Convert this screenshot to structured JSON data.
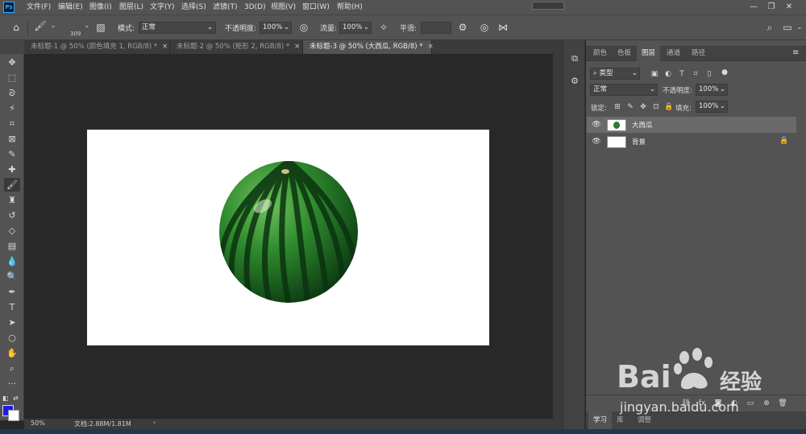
{
  "app": {
    "logo": "Ps",
    "menu": [
      "文件(F)",
      "编辑(E)",
      "图像(I)",
      "图层(L)",
      "文字(Y)",
      "选择(S)",
      "滤镜(T)",
      "3D(D)",
      "视图(V)",
      "窗口(W)",
      "帮助(H)"
    ],
    "window_controls": [
      "minimize",
      "restore",
      "close"
    ]
  },
  "options": {
    "brush_size": "309",
    "mode_label": "模式:",
    "mode_value": "正常",
    "opacity_label": "不透明度:",
    "opacity_value": "100%",
    "flow_label": "流量:",
    "flow_value": "100%",
    "smoothing_label": "平滑:",
    "smoothing_value": ""
  },
  "tabs": [
    {
      "label": "未标题-1 @ 50% (颜色填充 1, RGB/8) *",
      "active": false
    },
    {
      "label": "未标题-2 @ 50% (矩形 2, RGB/8) *",
      "active": false
    },
    {
      "label": "未标题-3 @ 50% (大西瓜, RGB/8) *",
      "active": true
    }
  ],
  "tools": [
    "move-icon",
    "marquee-icon",
    "lasso-icon",
    "magic-wand-icon",
    "crop-icon",
    "frame-icon",
    "eyedropper-icon",
    "healing-icon",
    "brush-icon",
    "stamp-icon",
    "history-brush-icon",
    "eraser-icon",
    "gradient-icon",
    "blur-icon",
    "dodge-icon",
    "pen-icon",
    "type-icon",
    "path-select-icon",
    "ellipse-icon",
    "hand-icon",
    "zoom-icon",
    "more-icon"
  ],
  "colors": {
    "foreground": "#1d1de8",
    "background": "#ffffff",
    "menubar": "#535353",
    "workspace": "#282828"
  },
  "status": {
    "zoom": "50%",
    "doc_info": "文档:2.88M/1.81M"
  },
  "panel": {
    "tabs": [
      "颜色",
      "色板",
      "图层",
      "通道",
      "路径"
    ],
    "active_tab": "图层",
    "filter_kind": "类型",
    "blend_mode": "正常",
    "opacity_label": "不透明度:",
    "opacity_value": "100%",
    "lock_label": "锁定:",
    "fill_label": "填充:",
    "fill_value": "100%",
    "layers": [
      {
        "name": "大西瓜",
        "selected": true,
        "visible": true,
        "locked": false
      },
      {
        "name": "背景",
        "selected": false,
        "visible": true,
        "locked": true
      }
    ],
    "bottom_tabs": [
      "学习",
      "库",
      "调整"
    ]
  },
  "watermark": {
    "brand": "Bai",
    "brand_suffix": "经验",
    "url": "jingyan.baidu.com"
  }
}
